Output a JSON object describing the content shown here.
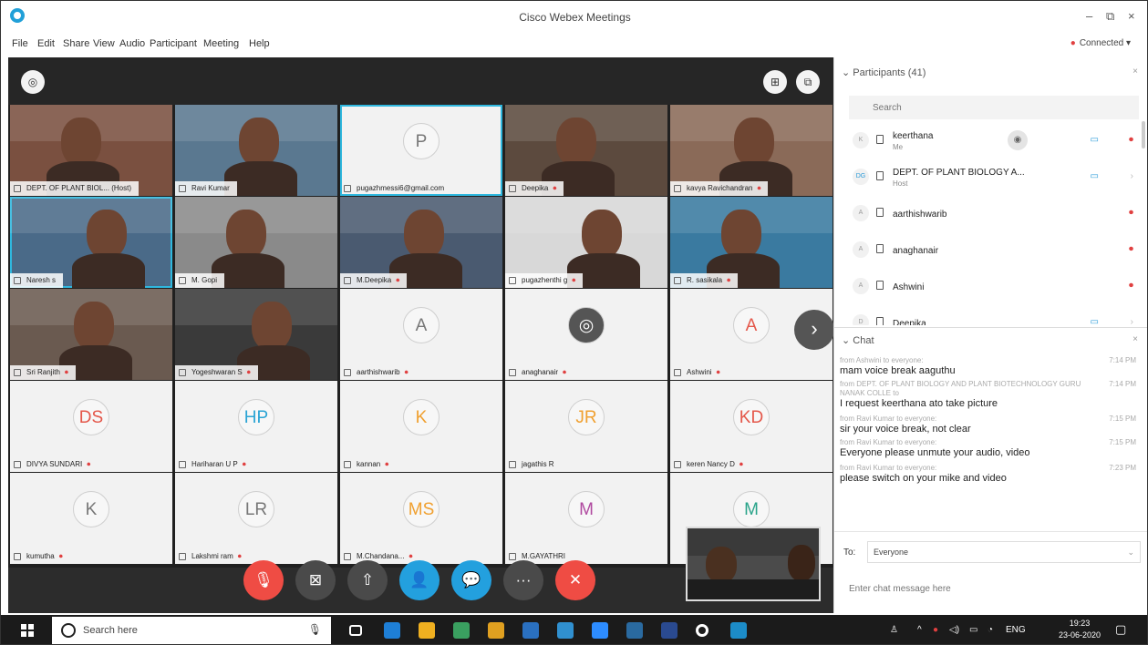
{
  "window": {
    "title": "Cisco Webex Meetings",
    "minimize": "–",
    "restore": "⧉",
    "close": "×"
  },
  "menu": [
    "File",
    "Edit",
    "Share",
    "View",
    "Audio",
    "Participant",
    "Meeting",
    "Help"
  ],
  "status": {
    "connected": "Connected ▾",
    "color": "#e04040"
  },
  "tiles": [
    {
      "name": "DEPT. OF PLANT BIOL...",
      "suffix": "(Host)",
      "type": "video",
      "mic": false,
      "highlight": false
    },
    {
      "name": "Ravi Kumar",
      "type": "video",
      "mic": false,
      "highlight": false
    },
    {
      "name": "pugazhmessi6@gmail.com",
      "type": "avatar",
      "initials": "P",
      "color": "#777777",
      "mic": false,
      "highlight": true
    },
    {
      "name": "Deepika",
      "type": "video",
      "mic": true,
      "highlight": false
    },
    {
      "name": "kavya Ravichandran",
      "type": "video",
      "mic": true,
      "highlight": false
    },
    {
      "name": "Naresh s",
      "type": "video",
      "mic": false,
      "highlight": true
    },
    {
      "name": "M. Gopi",
      "type": "video",
      "mic": false,
      "highlight": false
    },
    {
      "name": "M.Deepika",
      "type": "video",
      "mic": true,
      "highlight": false
    },
    {
      "name": "pugazhenthi g",
      "type": "video",
      "mic": true,
      "highlight": false
    },
    {
      "name": "R. sasikala",
      "type": "video",
      "mic": true,
      "highlight": false
    },
    {
      "name": "Sri Ranjith",
      "type": "video",
      "mic": true,
      "highlight": false
    },
    {
      "name": "Yogeshwaran S",
      "type": "video",
      "mic": true,
      "highlight": false
    },
    {
      "name": "aarthishwarib",
      "type": "avatar",
      "initials": "A",
      "color": "#777777",
      "mic": true,
      "highlight": false
    },
    {
      "name": "anaghanair",
      "type": "avatar",
      "initials": "◎",
      "color": "#ffffff",
      "mic": true,
      "highlight": false
    },
    {
      "name": "Ashwini",
      "type": "avatar",
      "initials": "A",
      "color": "#e4574a",
      "mic": true,
      "highlight": false
    },
    {
      "name": "DIVYA SUNDARI",
      "type": "avatar",
      "initials": "DS",
      "color": "#e4574a",
      "mic": true,
      "highlight": false
    },
    {
      "name": "Hariharan U P",
      "type": "avatar",
      "initials": "HP",
      "color": "#2aa4d4",
      "mic": true,
      "highlight": false
    },
    {
      "name": "kannan",
      "type": "avatar",
      "initials": "K",
      "color": "#f0a030",
      "mic": true,
      "highlight": false
    },
    {
      "name": "jagathis R",
      "type": "avatar",
      "initials": "JR",
      "color": "#f0a030",
      "mic": false,
      "highlight": false
    },
    {
      "name": "keren Nancy D",
      "type": "avatar",
      "initials": "KD",
      "color": "#e4574a",
      "mic": true,
      "highlight": false
    },
    {
      "name": "kumutha",
      "type": "avatar",
      "initials": "K",
      "color": "#777777",
      "mic": true,
      "highlight": false
    },
    {
      "name": "Lakshmi ram",
      "type": "avatar",
      "initials": "LR",
      "color": "#777777",
      "mic": true,
      "highlight": false
    },
    {
      "name": "M.Chandana...",
      "type": "avatar",
      "initials": "MS",
      "color": "#f0a030",
      "mic": true,
      "highlight": false
    },
    {
      "name": "M.GAYATHRI",
      "type": "avatar",
      "initials": "M",
      "color": "#b04aa0",
      "mic": false,
      "highlight": false
    },
    {
      "name": "",
      "type": "avatar",
      "initials": "M",
      "color": "#2aa48a",
      "mic": false,
      "highlight": false
    }
  ],
  "controls": [
    "🎙",
    "⊠",
    "⇧",
    "👤",
    "💬",
    "···",
    "✕"
  ],
  "panel": {
    "participants_title": "Participants (41)",
    "search_placeholder": "Search",
    "participants": [
      {
        "initials": "K",
        "name": "keerthana",
        "role": "Me",
        "mic": true,
        "cam": true
      },
      {
        "initials": "DG",
        "name": "DEPT. OF PLANT BIOLOGY A...",
        "role": "Host",
        "mic": false,
        "cam": true
      },
      {
        "initials": "A",
        "name": "aarthishwarib",
        "role": "",
        "mic": true,
        "cam": false
      },
      {
        "initials": "A",
        "name": "anaghanair",
        "role": "",
        "mic": true,
        "cam": false
      },
      {
        "initials": "A",
        "name": "Ashwini",
        "role": "",
        "mic": true,
        "cam": false
      },
      {
        "initials": "D",
        "name": "Deepika",
        "role": "",
        "mic": false,
        "cam": true
      }
    ],
    "chat_title": "Chat",
    "chat": [
      {
        "from": "from Ashwini to everyone:",
        "msg": "mam voice break aaguthu",
        "time": "7:14 PM"
      },
      {
        "from": "from DEPT. OF PLANT BIOLOGY AND PLANT BIOTECHNOLOGY GURU NANAK COLLE to",
        "msg": "I request keerthana ato take picture",
        "time": "7:14 PM"
      },
      {
        "from": "from Ravi Kumar to everyone:",
        "msg": "sir your voice break, not clear",
        "time": "7:15 PM"
      },
      {
        "from": "from Ravi Kumar to everyone:",
        "msg": "Everyone please unmute your audio, video",
        "time": "7:15 PM"
      },
      {
        "from": "from Ravi Kumar to everyone:",
        "msg": "please switch on your mike and video",
        "time": "7:23 PM"
      }
    ],
    "to_label": "To:",
    "to_value": "Everyone",
    "chat_placeholder": "Enter chat message here"
  },
  "taskbar": {
    "search": "Search here",
    "lang": "ENG",
    "time": "19:23",
    "date": "23-06-2020"
  }
}
